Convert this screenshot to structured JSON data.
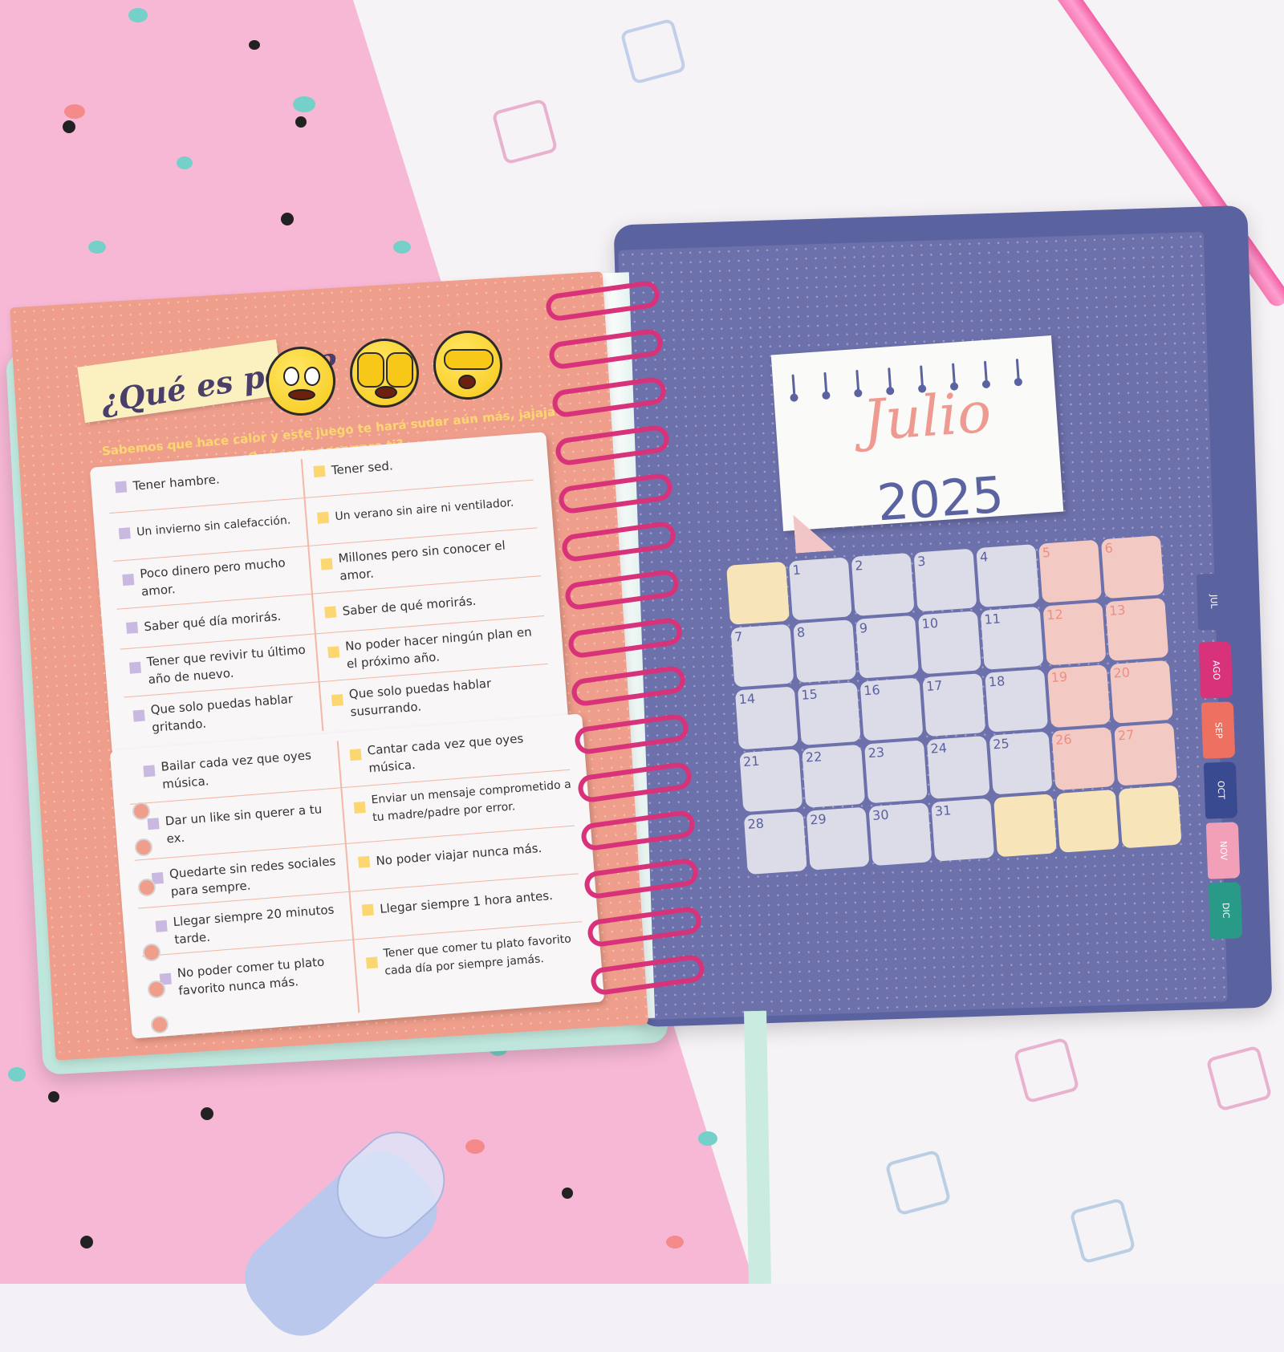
{
  "left_page": {
    "title": "¿Qué es peor?",
    "subtitle_line1": "Sabemos que hace calor y este juego te hará sudar aún más, jajaja...",
    "subtitle_line2": "¿Qué sería peor para ti?",
    "card1": {
      "left": [
        "Tener hambre.",
        "Un invierno sin calefacción.",
        "Poco dinero pero mucho amor.",
        "Saber qué día morirás.",
        "Tener que revivir tu último año de nuevo.",
        "Que solo puedas hablar gritando."
      ],
      "right": [
        "Tener sed.",
        "Un verano sin aire ni ventilador.",
        "Millones pero sin conocer el amor.",
        "Saber de qué morirás.",
        "No poder hacer ningún plan en el próximo año.",
        "Que solo puedas hablar susurrando."
      ]
    },
    "card2": {
      "left": [
        "Bailar cada vez que oyes música.",
        "Dar un like sin querer a tu ex.",
        "Quedarte sin redes sociales para sempre.",
        "Llegar siempre 20 minutos tarde.",
        "No poder comer tu plato favorito nunca más."
      ],
      "right": [
        "Cantar cada vez que oyes música.",
        "Enviar un mensaje comprometido a tu madre/padre por error.",
        "No poder viajar nunca más.",
        "Llegar siempre 1 hora antes.",
        "Tener que comer tu plato favorito cada día por siempre jamás."
      ]
    },
    "colors": {
      "left_square": "#c9b8e0",
      "right_square": "#fcd670"
    }
  },
  "right_page": {
    "month": "Julio",
    "year": "2025",
    "days": [
      "1",
      "2",
      "3",
      "4",
      "5",
      "6",
      "7",
      "8",
      "9",
      "10",
      "11",
      "12",
      "13",
      "14",
      "15",
      "16",
      "17",
      "18",
      "19",
      "20",
      "21",
      "22",
      "23",
      "24",
      "25",
      "26",
      "27",
      "28",
      "29",
      "30",
      "31"
    ],
    "tabs": [
      "JUL",
      "AGO",
      "SEP",
      "OCT",
      "NOV",
      "DIC"
    ],
    "tab_colors": [
      "#5a62a0",
      "#d8327a",
      "#ee7060",
      "#3a4a90",
      "#f2a0b8",
      "#2a9a88"
    ]
  }
}
